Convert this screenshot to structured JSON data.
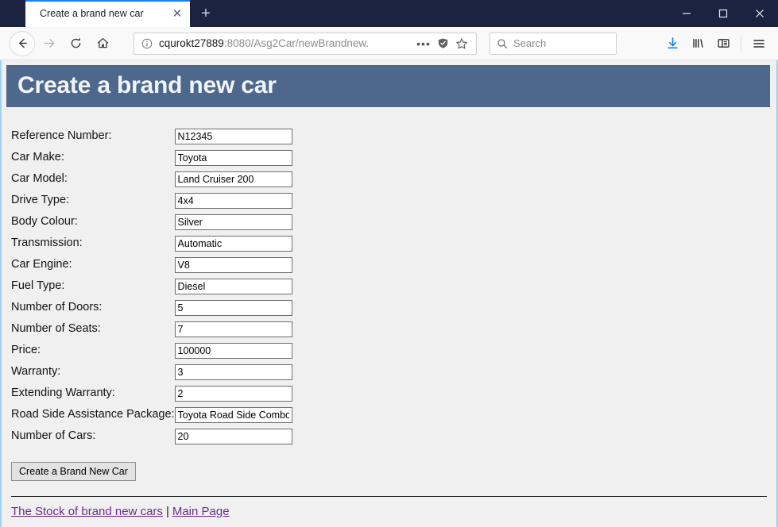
{
  "browser": {
    "tab": {
      "title": "Create a brand new car",
      "close_label": "✕"
    },
    "newtab_label": "+",
    "window_controls": {
      "minimize": "minimize",
      "maximize": "maximize",
      "close": "close"
    },
    "nav": {
      "back": "Back",
      "forward": "Forward",
      "reload": "Reload",
      "home": "Home"
    },
    "url": {
      "host": "cqurokt27889",
      "rest": ":8080/Asg2Car/newBrandnew.",
      "identity_icon": "info-circle-icon",
      "page_actions": "•••",
      "container_icon": "shield-icon",
      "bookmark_icon": "star-icon"
    },
    "search": {
      "placeholder": "Search",
      "icon": "search-icon"
    },
    "toolbar": {
      "downloads": "downloads-icon",
      "library": "library-icon",
      "sidebar": "sidebar-icon",
      "menu": "hamburger-menu-icon"
    }
  },
  "page": {
    "heading": "Create a brand new car",
    "fields": [
      {
        "label": "Reference Number:",
        "value": "N12345"
      },
      {
        "label": "Car Make:",
        "value": "Toyota"
      },
      {
        "label": "Car Model:",
        "value": "Land Cruiser 200"
      },
      {
        "label": "Drive Type:",
        "value": "4x4"
      },
      {
        "label": "Body Colour:",
        "value": "Silver"
      },
      {
        "label": "Transmission:",
        "value": "Automatic"
      },
      {
        "label": "Car Engine:",
        "value": "V8"
      },
      {
        "label": "Fuel Type:",
        "value": "Diesel"
      },
      {
        "label": "Number of Doors:",
        "value": "5"
      },
      {
        "label": "Number of Seats:",
        "value": "7"
      },
      {
        "label": "Price:",
        "value": "100000"
      },
      {
        "label": "Warranty:",
        "value": "3"
      },
      {
        "label": "Extending Warranty:",
        "value": "2"
      },
      {
        "label": "Road Side Assistance Package:",
        "value": "Toyota Road Side Combo"
      },
      {
        "label": "Number of Cars:",
        "value": "20"
      }
    ],
    "submit_label": "Create a Brand New Car",
    "footer_links": [
      {
        "text": "The Stock of brand new cars"
      },
      {
        "text": "Main Page"
      }
    ],
    "footer_separator": "|"
  },
  "colors": {
    "banner": "#4e678c",
    "titlebar": "#1c2340",
    "tab_accent": "#0a84ff",
    "link": "#6b2c91",
    "page_bg": "#f0f0f0"
  }
}
